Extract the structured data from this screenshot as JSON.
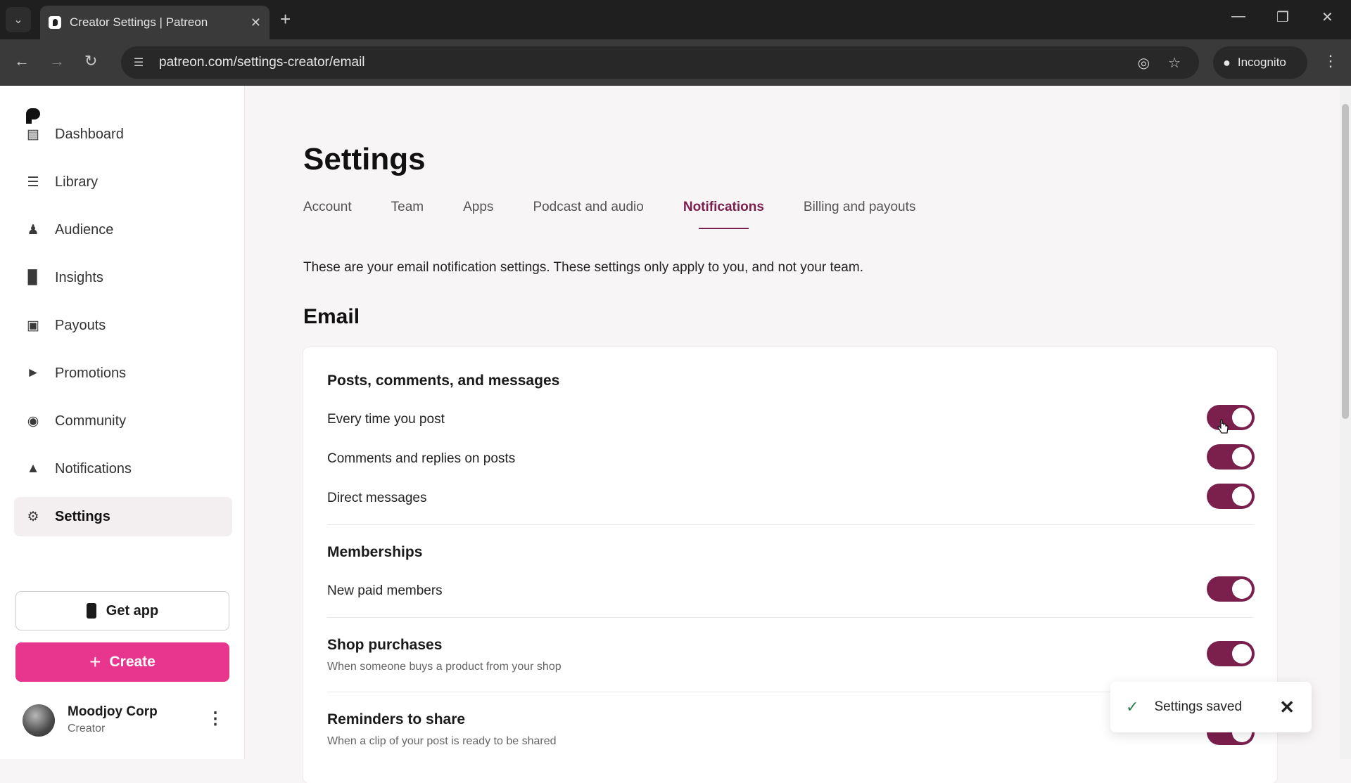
{
  "browser": {
    "tab_title": "Creator Settings | Patreon",
    "url": "patreon.com/settings-creator/email",
    "incognito_label": "Incognito"
  },
  "sidebar": {
    "items": [
      {
        "label": "Dashboard",
        "icon": "dashboard-icon"
      },
      {
        "label": "Library",
        "icon": "library-icon"
      },
      {
        "label": "Audience",
        "icon": "audience-icon"
      },
      {
        "label": "Insights",
        "icon": "insights-icon"
      },
      {
        "label": "Payouts",
        "icon": "payouts-icon"
      },
      {
        "label": "Promotions",
        "icon": "promotions-icon"
      },
      {
        "label": "Community",
        "icon": "community-icon"
      },
      {
        "label": "Notifications",
        "icon": "bell-icon"
      },
      {
        "label": "Settings",
        "icon": "gear-icon",
        "active": true
      }
    ],
    "get_app_label": "Get app",
    "create_label": "Create",
    "profile": {
      "name": "Moodjoy Corp",
      "role": "Creator"
    }
  },
  "main": {
    "title": "Settings",
    "tabs": [
      {
        "label": "Account"
      },
      {
        "label": "Team"
      },
      {
        "label": "Apps"
      },
      {
        "label": "Podcast and audio"
      },
      {
        "label": "Notifications",
        "active": true
      },
      {
        "label": "Billing and payouts"
      }
    ],
    "intro": "These are your email notification settings. These settings only apply to you, and not your team.",
    "section_title": "Email",
    "groups": {
      "posts": {
        "title": "Posts, comments, and messages",
        "rows": [
          {
            "label": "Every time you post",
            "enabled": true
          },
          {
            "label": "Comments and replies on posts",
            "enabled": true
          },
          {
            "label": "Direct messages",
            "enabled": true
          }
        ]
      },
      "memberships": {
        "title": "Memberships",
        "rows": [
          {
            "label": "New paid members",
            "enabled": true
          }
        ]
      },
      "shop": {
        "title": "Shop purchases",
        "subtitle": "When someone buys a product from your shop",
        "enabled": true
      },
      "reminders": {
        "title": "Reminders to share",
        "subtitle": "When a clip of your post is ready to be shared",
        "enabled": true
      }
    }
  },
  "toast": {
    "text": "Settings saved"
  },
  "colors": {
    "accent": "#7b1f4d",
    "create": "#e8368f"
  }
}
